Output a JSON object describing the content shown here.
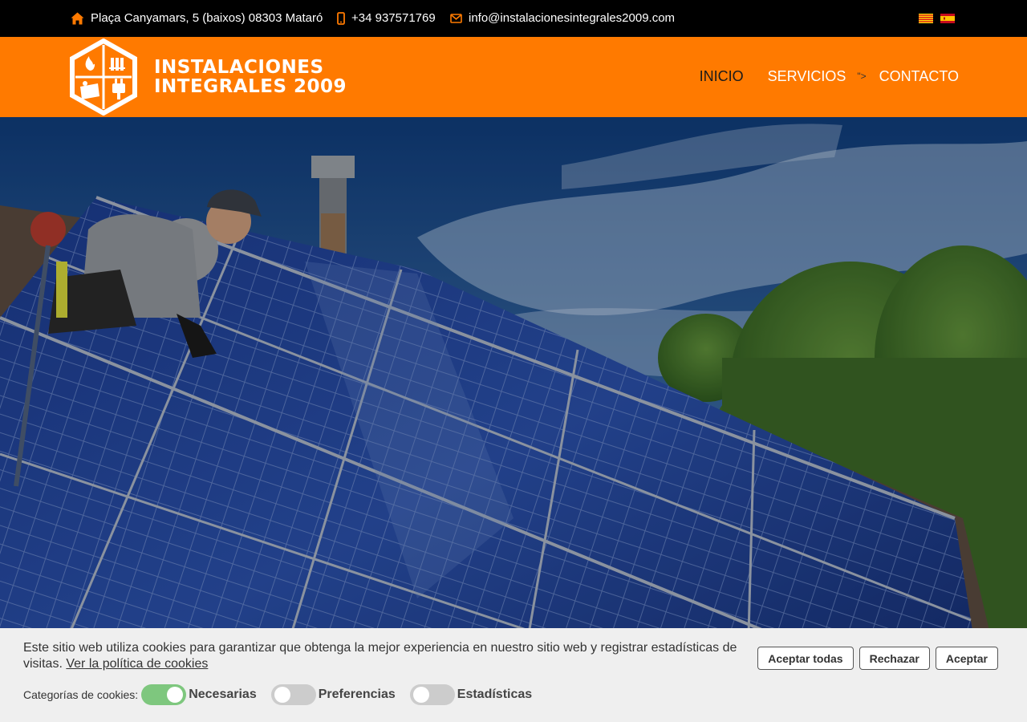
{
  "topbar": {
    "address": "Plaça Canyamars, 5 (baixos) 08303 Mataró",
    "phone": "+34 937571769",
    "email": "info@instalacionesintegrales2009.com",
    "icons": [
      "home-icon",
      "mobile-phone-icon",
      "envelope-icon"
    ],
    "languages": [
      "catalan-flag",
      "spanish-flag"
    ]
  },
  "header": {
    "logo_line1": "INSTALACIONES",
    "logo_line2": "INTEGRALES 2009",
    "nav": [
      {
        "label": "INICIO",
        "active": true
      },
      {
        "label": "SERVICIOS",
        "active": false
      },
      {
        "label": "CONTACTO",
        "active": false
      }
    ],
    "stray_text": "\">"
  },
  "colors": {
    "brand_orange": "#ff7a00",
    "topbar_black": "#000000",
    "toggle_on": "#7ec77e",
    "toggle_off": "#cccccc"
  },
  "cookie_banner": {
    "message": "Este sitio web utiliza cookies para garantizar que obtenga la mejor experiencia en nuestro sitio web y registrar estadísticas de visitas.",
    "policy_link": "Ver la política de cookies",
    "buttons": {
      "accept_all": "Aceptar todas",
      "reject": "Rechazar",
      "accept": "Aceptar"
    },
    "categories_label": "Categorías de cookies:",
    "categories": [
      {
        "label": "Necesarias",
        "enabled": true
      },
      {
        "label": "Preferencias",
        "enabled": false
      },
      {
        "label": "Estadísticas",
        "enabled": false
      }
    ]
  }
}
